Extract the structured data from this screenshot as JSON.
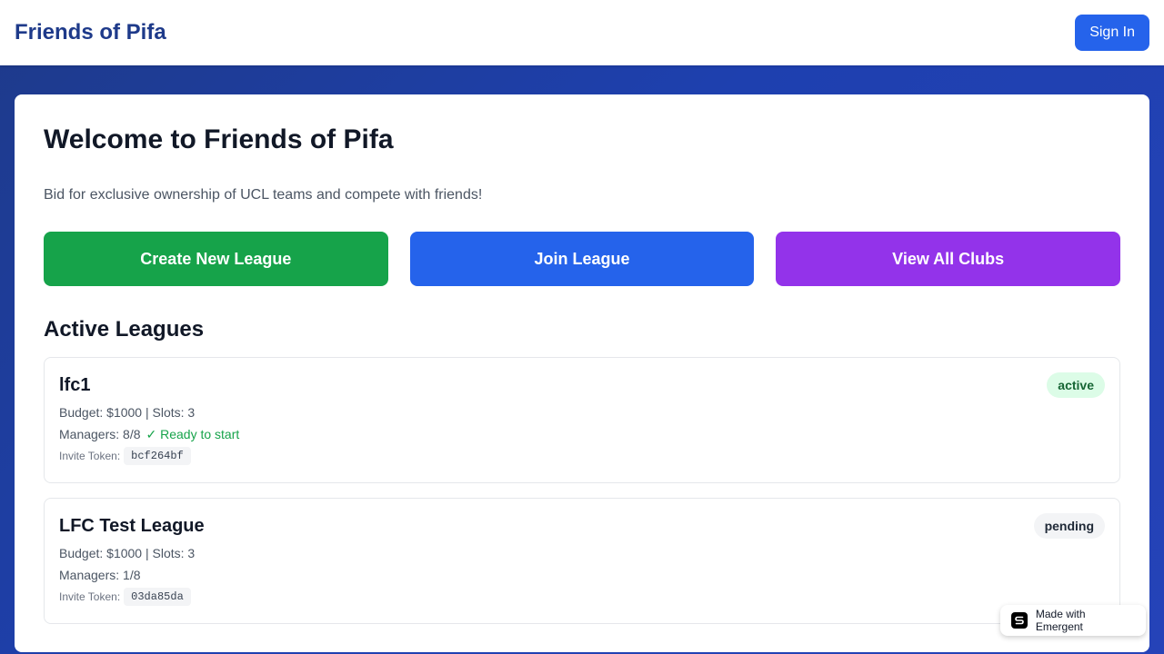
{
  "header": {
    "brand": "Friends of Pifa",
    "sign_in": "Sign In"
  },
  "main": {
    "title": "Welcome to Friends of Pifa",
    "subtitle": "Bid for exclusive ownership of UCL teams and compete with friends!",
    "actions": [
      {
        "label": "Create New League",
        "color": "#16a34a"
      },
      {
        "label": "Join League",
        "color": "#2563eb"
      },
      {
        "label": "View All Clubs",
        "color": "#9333ea"
      }
    ],
    "section_title": "Active Leagues",
    "leagues": [
      {
        "name": "lfc1",
        "status": "active",
        "budget_line": "Budget: $1000 | Slots: 3",
        "managers_line": "Managers: 8/8",
        "ready_text": "✓ Ready to start",
        "token_label": "Invite Token:",
        "token": "bcf264bf"
      },
      {
        "name": "LFC Test League",
        "status": "pending",
        "budget_line": "Budget: $1000 | Slots: 3",
        "managers_line": "Managers: 1/8",
        "token_label": "Invite Token:",
        "token": "03da85da"
      }
    ]
  },
  "badge": {
    "label": "Made with Emergent",
    "icon": "emergent-logo-icon"
  },
  "colors": {
    "brand": "#1e3a8a",
    "primary": "#2563eb",
    "success": "#16a34a",
    "purple": "#9333ea"
  }
}
